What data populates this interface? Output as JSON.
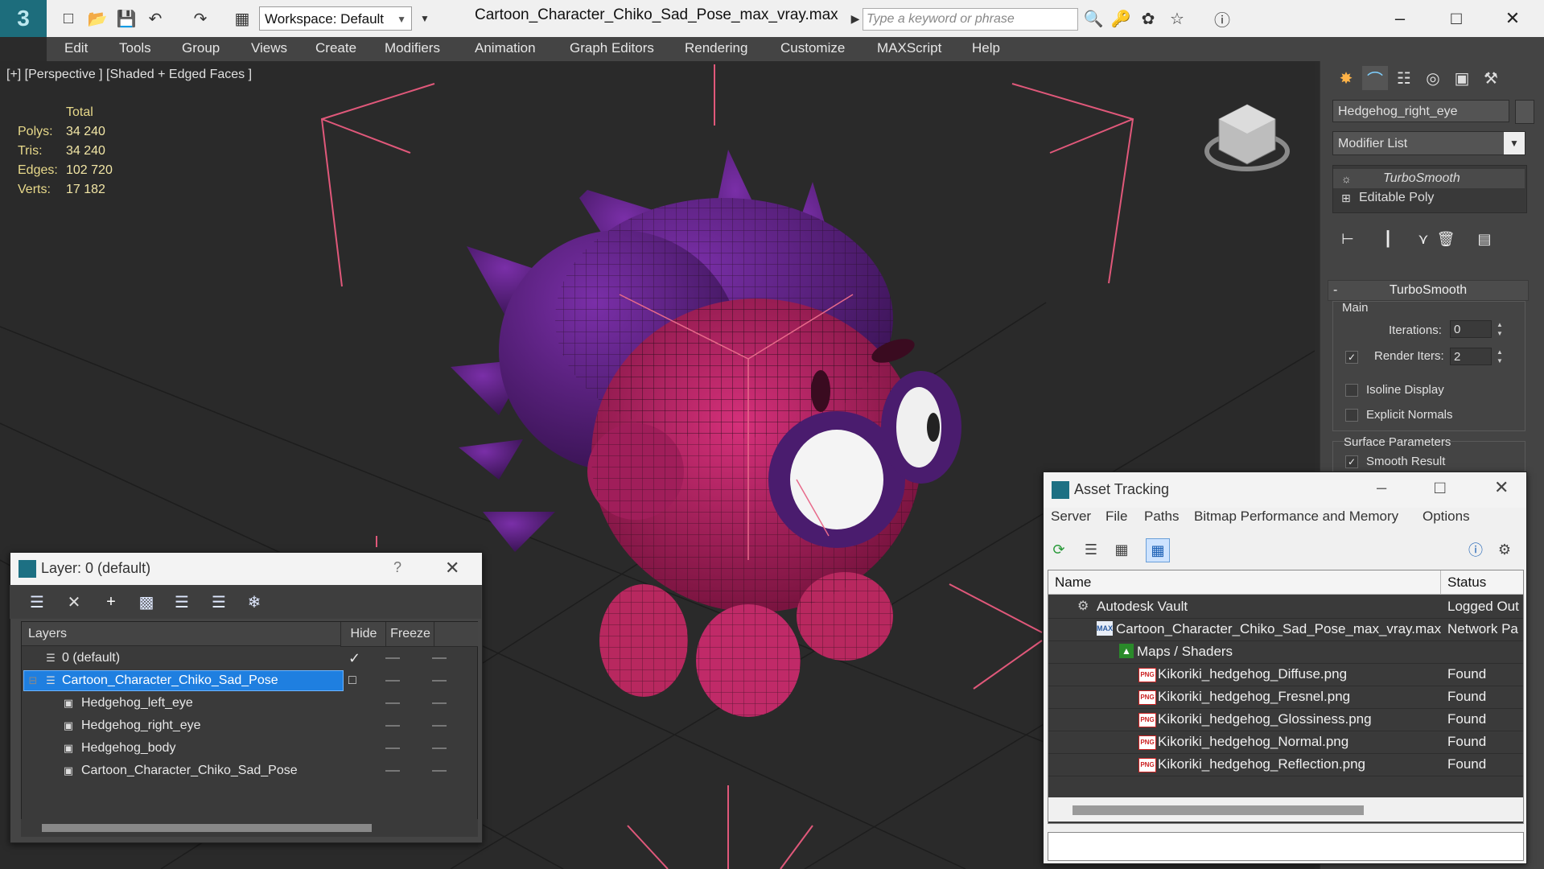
{
  "titlebar": {
    "workspace": "Workspace: Default",
    "document_title": "Cartoon_Character_Chiko_Sad_Pose_max_vray.max",
    "search_placeholder": "Type a keyword or phrase"
  },
  "menu": [
    "Edit",
    "Tools",
    "Group",
    "Views",
    "Create",
    "Modifiers",
    "Animation",
    "Graph Editors",
    "Rendering",
    "Customize",
    "MAXScript",
    "Help"
  ],
  "viewport": {
    "label": "[+] [Perspective ] [Shaded + Edged Faces ]",
    "stats": {
      "header": "Total",
      "rows": [
        {
          "k": "Polys:",
          "v": "34 240"
        },
        {
          "k": "Tris:",
          "v": "34 240"
        },
        {
          "k": "Edges:",
          "v": "102 720"
        },
        {
          "k": "Verts:",
          "v": "17 182"
        }
      ]
    }
  },
  "command_panel": {
    "object_name": "Hedgehog_right_eye",
    "modifier_list": "Modifier List",
    "stack": [
      "TurboSmooth",
      "Editable Poly"
    ],
    "rollout_title": "TurboSmooth",
    "main_label": "Main",
    "iterations_label": "Iterations:",
    "iterations_value": "0",
    "render_iters_label": "Render Iters:",
    "render_iters_value": "2",
    "isoline": "Isoline Display",
    "explicit_normals": "Explicit Normals",
    "surface_params": "Surface Parameters",
    "smooth_result": "Smooth Result"
  },
  "layer_window": {
    "title": "Layer: 0 (default)",
    "help": "?",
    "columns": [
      "Layers",
      "Hide",
      "Freeze"
    ],
    "rows": [
      {
        "name": "0 (default)"
      },
      {
        "name": "Cartoon_Character_Chiko_Sad_Pose"
      },
      {
        "name": "Hedgehog_left_eye"
      },
      {
        "name": "Hedgehog_right_eye"
      },
      {
        "name": "Hedgehog_body"
      },
      {
        "name": "Cartoon_Character_Chiko_Sad_Pose"
      }
    ]
  },
  "asset_window": {
    "title": "Asset Tracking",
    "menu": [
      "Server",
      "File",
      "Paths",
      "Bitmap Performance and Memory",
      "Options"
    ],
    "columns": [
      "Name",
      "Status"
    ],
    "rows": [
      {
        "name": "Autodesk Vault",
        "status": "Logged Out"
      },
      {
        "name": "Cartoon_Character_Chiko_Sad_Pose_max_vray.max",
        "status": "Network Pa"
      },
      {
        "name": "Maps / Shaders",
        "status": ""
      },
      {
        "name": "Kikoriki_hedgehog_Diffuse.png",
        "status": "Found"
      },
      {
        "name": "Kikoriki_hedgehog_Fresnel.png",
        "status": "Found"
      },
      {
        "name": "Kikoriki_hedgehog_Glossiness.png",
        "status": "Found"
      },
      {
        "name": "Kikoriki_hedgehog_Normal.png",
        "status": "Found"
      },
      {
        "name": "Kikoriki_hedgehog_Reflection.png",
        "status": "Found"
      }
    ]
  }
}
